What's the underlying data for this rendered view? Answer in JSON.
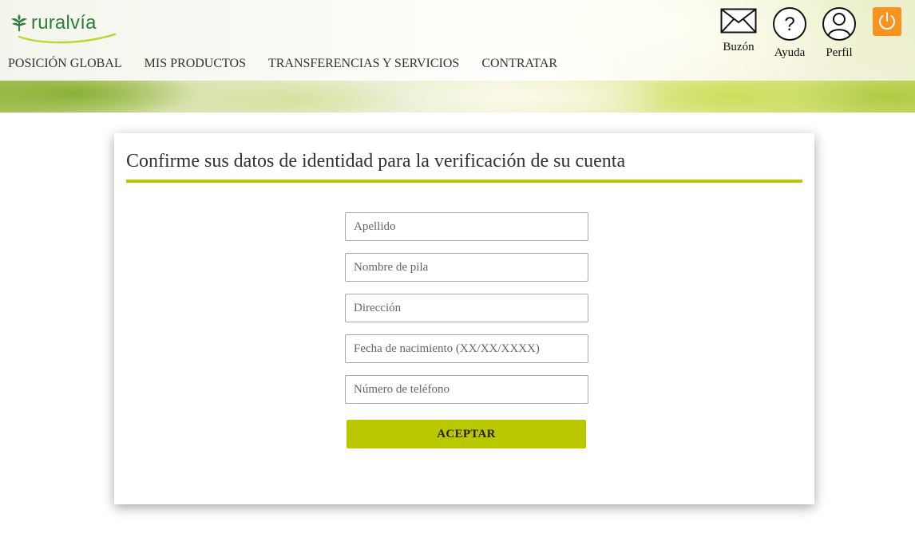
{
  "brand": {
    "name": "ruralvía",
    "green": "#2f7d3e",
    "accent": "#b9c800",
    "power_color": "#f7931e"
  },
  "nav": {
    "items": [
      {
        "label": "POSICIÓN GLOBAL"
      },
      {
        "label": "MIS PRODUCTOS"
      },
      {
        "label": "TRANSFERENCIAS Y SERVICIOS"
      },
      {
        "label": "CONTRATAR"
      }
    ]
  },
  "tools": {
    "mail": {
      "label": "Buzón",
      "icon": "envelope-icon"
    },
    "help": {
      "label": "Ayuda",
      "icon": "help-circle-icon"
    },
    "profile": {
      "label": "Perfil",
      "icon": "user-icon"
    },
    "power": {
      "icon": "power-icon"
    }
  },
  "form": {
    "title": "Confirme sus datos de identidad para la verificación de su cuenta",
    "fields": [
      {
        "placeholder": "Apellido",
        "value": ""
      },
      {
        "placeholder": "Nombre de pila",
        "value": ""
      },
      {
        "placeholder": "Dirección",
        "value": ""
      },
      {
        "placeholder": "Fecha de nacimiento (XX/XX/XXXX)",
        "value": ""
      },
      {
        "placeholder": "Número de teléfono",
        "value": ""
      }
    ],
    "submit_label": "ACEPTAR"
  }
}
